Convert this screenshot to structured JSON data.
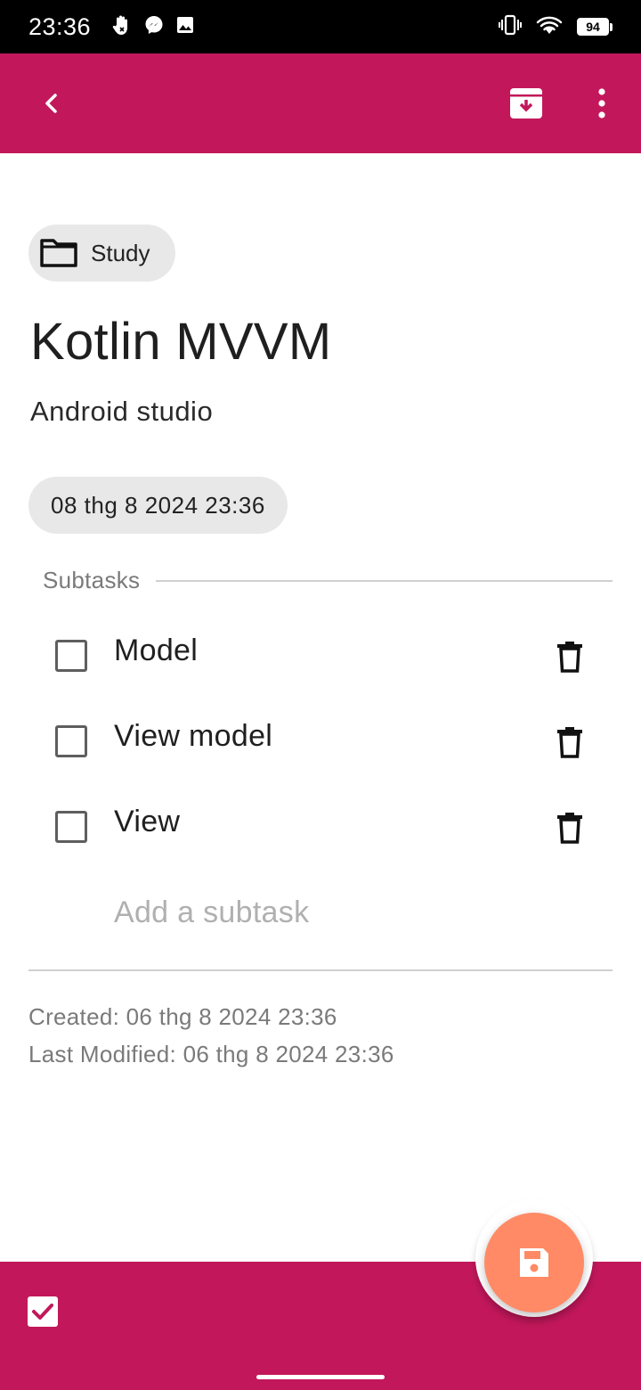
{
  "status_bar": {
    "time": "23:36",
    "battery": "94"
  },
  "app_bar": {
    "back_icon": "chevron-left-icon",
    "archive_icon": "archive-icon",
    "more_icon": "more-vert-icon"
  },
  "task": {
    "category": "Study",
    "title": "Kotlin MVVM",
    "description": "Android studio",
    "due_date": "08 thg 8 2024 23:36"
  },
  "subtasks": {
    "header": "Subtasks",
    "items": [
      {
        "text": "Model",
        "checked": false
      },
      {
        "text": "View model",
        "checked": false
      },
      {
        "text": "View",
        "checked": false
      }
    ],
    "add_placeholder": "Add a subtask"
  },
  "meta": {
    "created": "Created: 06 thg 8 2024 23:36",
    "last_modified": "Last Modified: 06 thg 8 2024 23:36"
  },
  "colors": {
    "primary": "#c2185b",
    "fab": "#ff8a65",
    "chip_bg": "#e8e8e8"
  }
}
